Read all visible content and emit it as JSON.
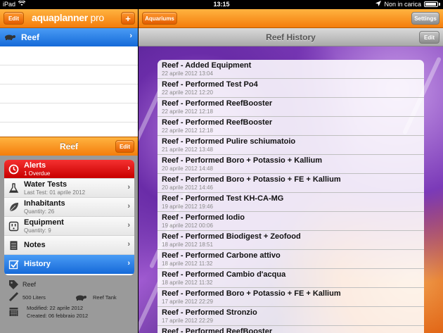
{
  "status_bar": {
    "device": "iPad",
    "time": "13:15",
    "charging": "Non in carica"
  },
  "left_toolbar": {
    "edit_label": "Edit",
    "logo_main": "aquaplanner",
    "logo_suffix": "pro",
    "add_label": "+"
  },
  "right_toolbar": {
    "aquariums_label": "Aquariums",
    "settings_label": "Settings"
  },
  "aquarium_list": {
    "selected": "Reef"
  },
  "detail_panel": {
    "title": "Reef",
    "edit_label": "Edit",
    "menu": [
      {
        "id": "alerts",
        "title": "Alerts",
        "subtitle": "1 Overdue",
        "icon": "clock-icon"
      },
      {
        "id": "water-tests",
        "title": "Water Tests",
        "subtitle": "Last Test: 01 aprile 2012",
        "icon": "flask-icon"
      },
      {
        "id": "inhabitants",
        "title": "Inhabitants",
        "subtitle": "Quantity: 26",
        "icon": "leaf-icon"
      },
      {
        "id": "equipment",
        "title": "Equipment",
        "subtitle": "Quantity: 9",
        "icon": "plug-icon"
      },
      {
        "id": "notes",
        "title": "Notes",
        "icon": "notepad-icon"
      },
      {
        "id": "history",
        "title": "History",
        "icon": "checkbox-icon"
      }
    ],
    "info": {
      "name": "Reef",
      "volume": "500 Liters",
      "tank_type": "Reef Tank",
      "modified": "Modified: 22 aprile 2012",
      "created": "Created: 06 febbraio 2012"
    }
  },
  "history_view": {
    "title": "Reef History",
    "edit_label": "Edit",
    "entries": [
      {
        "title": "Reef - Added Equipment",
        "date": "22 aprile 2012 13:04"
      },
      {
        "title": "Reef - Performed Test Po4",
        "date": "22 aprile 2012 12:20"
      },
      {
        "title": "Reef - Performed ReefBooster",
        "date": "22 aprile 2012 12:18"
      },
      {
        "title": "Reef - Performed ReefBooster",
        "date": "22 aprile 2012 12:18"
      },
      {
        "title": "Reef - Performed Pulire schiumatoio",
        "date": "21 aprile 2012 13:48"
      },
      {
        "title": "Reef - Performed Boro + Potassio + Kallium",
        "date": "20 aprile 2012 14:48"
      },
      {
        "title": "Reef - Performed Boro + Potassio + FE + Kallium",
        "date": "20 aprile 2012 14:46"
      },
      {
        "title": "Reef - Performed Test KH-CA-MG",
        "date": "19 aprile 2012 19:46"
      },
      {
        "title": "Reef - Performed Iodio",
        "date": "19 aprile 2012 00:06"
      },
      {
        "title": "Reef - Performed Biodigest + Zeofood",
        "date": "18 aprile 2012 18:51"
      },
      {
        "title": "Reef - Performed Carbone attivo",
        "date": "18 aprile 2012 11:32"
      },
      {
        "title": "Reef - Performed Cambio d'acqua",
        "date": "18 aprile 2012 11:32"
      },
      {
        "title": "Reef - Performed Boro + Potassio + FE + Kallium",
        "date": "17 aprile 2012 22:29"
      },
      {
        "title": "Reef - Performed Stronzio",
        "date": "17 aprile 2012 22:29"
      },
      {
        "title": "Reef - Performed ReefBooster",
        "date": ""
      }
    ]
  },
  "colors": {
    "toolbar_orange": "#f47d0c",
    "selection_blue": "#1569d8",
    "alert_red": "#c80000"
  }
}
